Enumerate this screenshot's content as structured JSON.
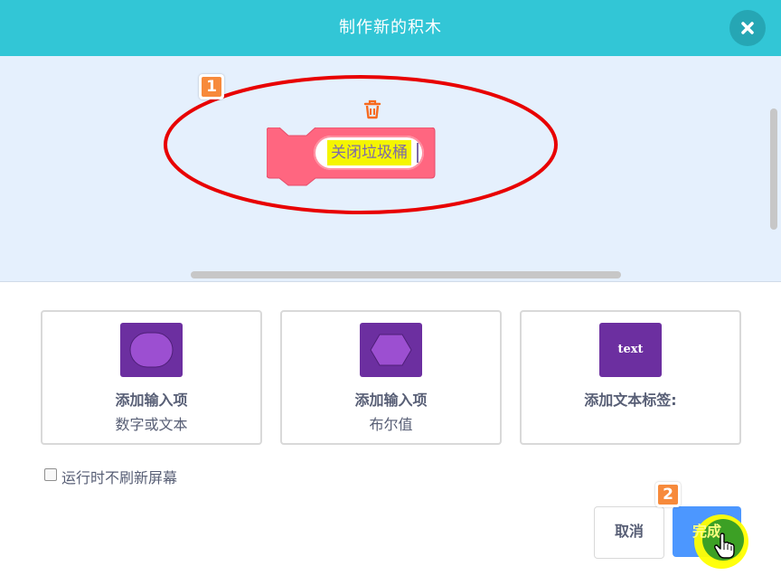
{
  "dialog": {
    "title": "制作新的积木",
    "close_icon": "close-x-icon"
  },
  "workspace": {
    "block_label": "关闭垃圾桶",
    "trash_icon": "trash-icon",
    "annotation_step_1": "1",
    "annotation_color": "#e80000"
  },
  "options": [
    {
      "icon": "round-input-icon",
      "title": "添加输入项",
      "subtitle": "数字或文本"
    },
    {
      "icon": "boolean-input-icon",
      "title": "添加输入项",
      "subtitle": "布尔值"
    },
    {
      "icon": "text-label-icon",
      "icon_text": "text",
      "title": "添加文本标签:",
      "subtitle": ""
    }
  ],
  "run_without_refresh": {
    "label": "运行时不刷新屏幕",
    "checked": false
  },
  "footer": {
    "cancel_label": "取消",
    "ok_label": "完成",
    "annotation_step_2": "2"
  },
  "colors": {
    "header": "#32c6d6",
    "workspace_bg": "#e5f0fd",
    "block": "#ff6680",
    "icon_purple": "#6c2fa0",
    "ok_button": "#4c97ff",
    "badge": "#f78a3b"
  }
}
